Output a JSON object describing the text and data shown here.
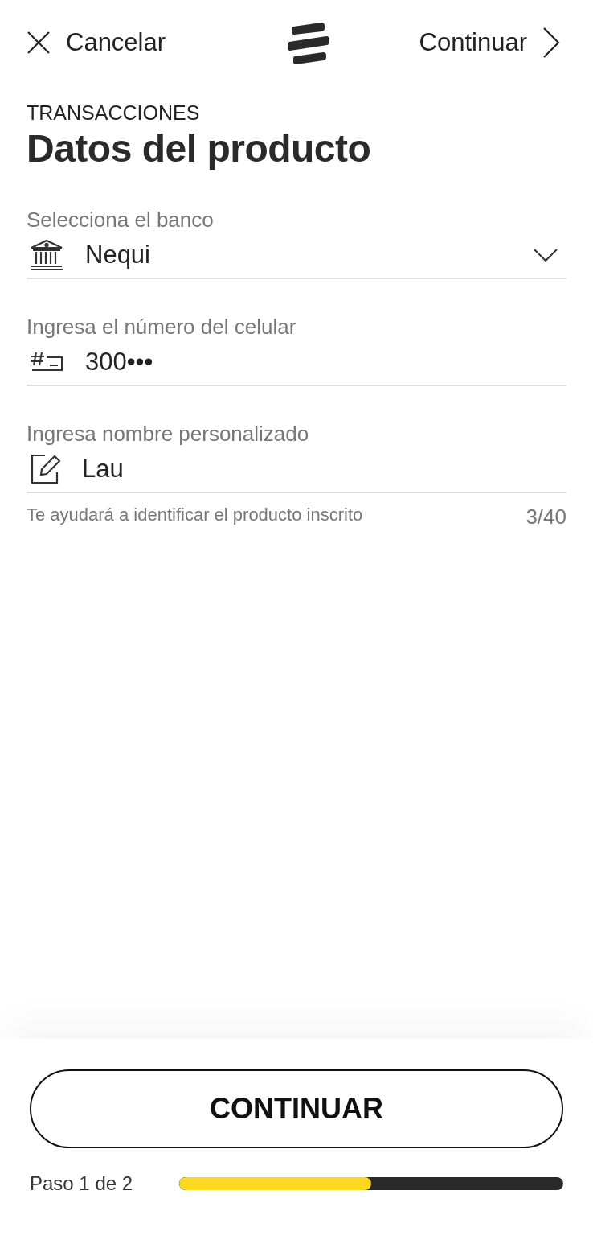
{
  "header": {
    "cancel": "Cancelar",
    "next": "Continuar"
  },
  "section": "TRANSACCIONES",
  "title": "Datos del producto",
  "fields": [
    {
      "kind": "select",
      "label": "Selecciona el banco",
      "value": "Nequi"
    },
    {
      "kind": "input",
      "label": "Ingresa el número del celular",
      "value": "300•••"
    },
    {
      "kind": "input",
      "label": "Ingresa nombre personalizado",
      "value": "Lau",
      "helper": "Te ayudará a identificar el producto inscrito",
      "counter": "3/40"
    }
  ],
  "button": "CONTINUAR",
  "progress": {
    "label": "Paso 1 de 2",
    "level": 0.5
  }
}
